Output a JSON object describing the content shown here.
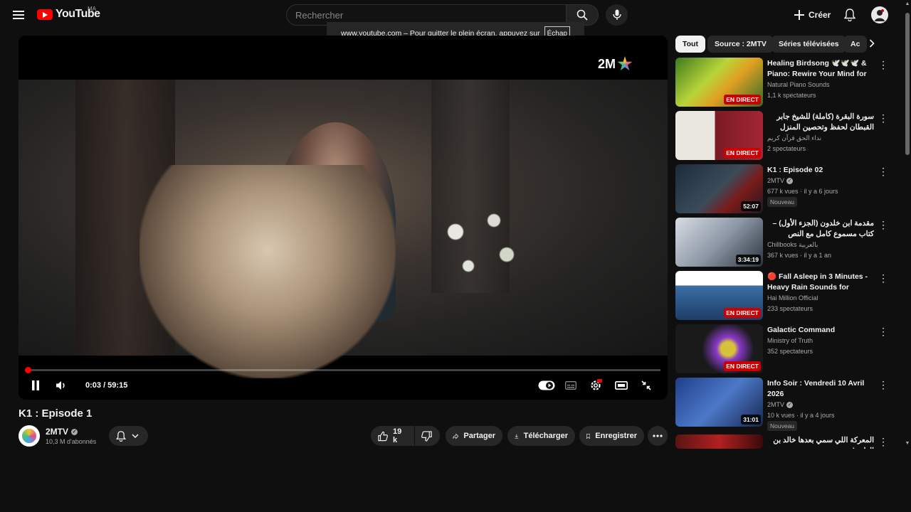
{
  "header": {
    "logo_text": "YouTube",
    "country_code": "MA",
    "search_placeholder": "Rechercher",
    "create_label": "Créer"
  },
  "fullscreen_tooltip": {
    "message": "www.youtube.com – Pour quitter le plein écran, appuyez sur",
    "key": "Échap"
  },
  "player": {
    "channel_watermark": "2M",
    "current_time": "0:03",
    "duration": "59:15",
    "time_display": "0:03 / 59:15",
    "progress_fraction": 0.0008,
    "settings_badge": "HD",
    "colors": {
      "progress": "#ff0000"
    }
  },
  "video": {
    "title": "K1 : Episode 1",
    "channel": "2MTV",
    "subscribers": "10,3 M d'abonnés",
    "likes": "19 k",
    "share_label": "Partager",
    "download_label": "Télécharger",
    "save_label": "Enregistrer"
  },
  "chips": [
    "Tout",
    "Source : 2MTV",
    "Séries télévisées",
    "Ac"
  ],
  "recommendations": [
    {
      "title": "Healing Birdsong 🕊️🕊️🕊️ & Piano: Rewire Your Mind for ...",
      "channel": "Natural Piano Sounds",
      "meta": "1,1 k spectateurs",
      "badge": "EN DIRECT",
      "live": true,
      "verified": false,
      "new": ""
    },
    {
      "title": "سورة البقرة (كاملة) للشيخ جابر القبطان لحفظ وتحصين المنزل وجلب البركة تلاوة رائعة ...",
      "channel": "نداء الحق قرآن كريم",
      "meta": "2 spectateurs",
      "badge": "EN DIRECT",
      "live": true,
      "verified": false,
      "new": ""
    },
    {
      "title": "K1 : Episode 02",
      "channel": "2MTV",
      "meta": "677 k vues · il y a 6 jours",
      "badge": "52:07",
      "live": false,
      "verified": true,
      "new": "Nouveau"
    },
    {
      "title": "مقدمة ابن خلدون (الجزء الأول) – كتاب مسموع كامل مع النص (كابشن)",
      "channel": "Chillbooks بالعربية",
      "meta": "367 k vues · il y a 1 an",
      "badge": "3:34:19",
      "live": false,
      "verified": false,
      "new": ""
    },
    {
      "title": "🔴 Fall Asleep in 3 Minutes - Heavy Rain Sounds for Peacef...",
      "channel": "Hai Million Official",
      "meta": "233 spectateurs",
      "badge": "EN DIRECT",
      "live": true,
      "verified": false,
      "new": ""
    },
    {
      "title": "Galactic Command",
      "channel": "Ministry of Truth",
      "meta": "352 spectateurs",
      "badge": "EN DIRECT",
      "live": true,
      "verified": false,
      "new": ""
    },
    {
      "title": "Info Soir : Vendredi 10 Avril 2026",
      "channel": "2MTV",
      "meta": "10 k vues · il y a 4 jours",
      "badge": "31:01",
      "live": false,
      "verified": true,
      "new": "Nouveau"
    },
    {
      "title": "المعركة اللي سمي بعدها خالد بن الوليد (",
      "channel": "",
      "meta": "",
      "badge": "",
      "live": false,
      "verified": false,
      "new": ""
    }
  ]
}
